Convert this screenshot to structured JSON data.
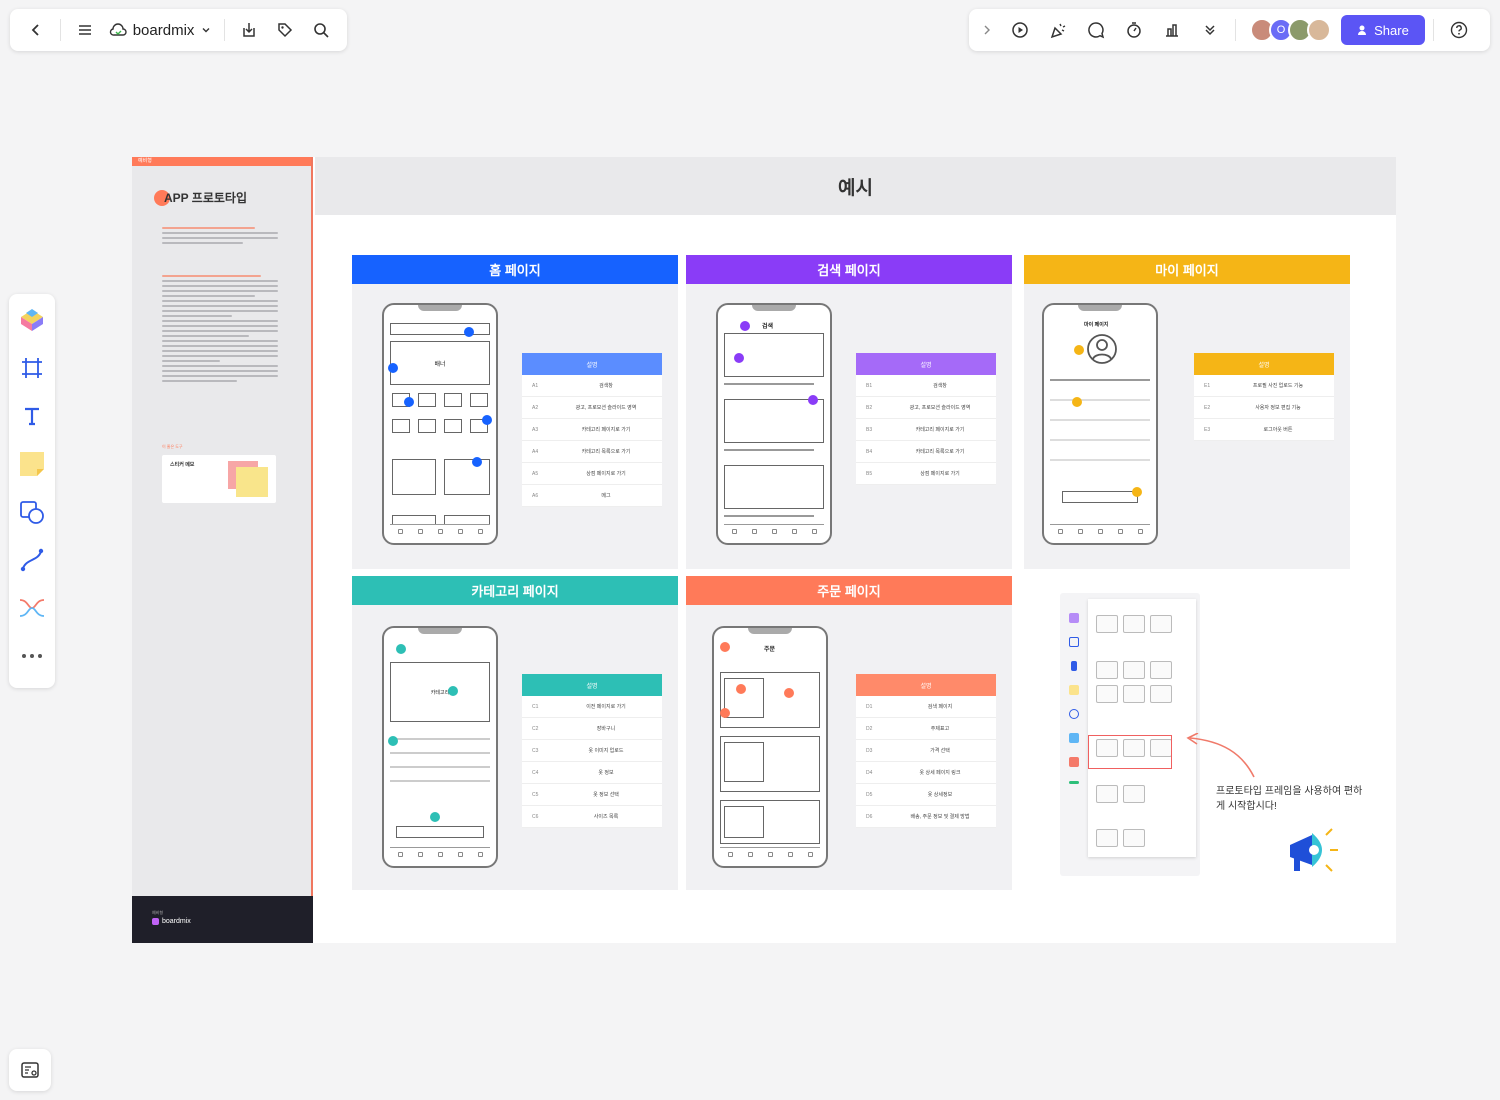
{
  "app": {
    "name": "boardmix",
    "share_label": "Share"
  },
  "colors": {
    "blue": "#1662ff",
    "purple": "#8a3cf7",
    "yellow": "#f5b516",
    "teal": "#2dbfb5",
    "coral": "#ff7a59",
    "share": "#5b55f5"
  },
  "toolbar_icons": {
    "left": [
      "back-icon",
      "menu-icon",
      "cloud-icon",
      "chevron-down-icon",
      "export-icon",
      "tag-icon",
      "search-icon"
    ],
    "right": [
      "chevron-right-icon",
      "play-icon",
      "celebrate-icon",
      "comment-icon",
      "timer-icon",
      "vote-icon",
      "more-icon",
      "help-icon"
    ],
    "side": [
      "template-icon",
      "frame-icon",
      "text-icon",
      "sticky-note-icon",
      "shape-icon",
      "connector-icon",
      "mindmap-icon",
      "more-dots-icon"
    ]
  },
  "sidebar": {
    "tag": "예비형",
    "title": "APP 프로토타입",
    "tip_title": "이 줄은 도구",
    "note_title": "스티커 메모",
    "footer_brand": "boardmix",
    "footer_small": "예비형"
  },
  "board": {
    "heading": "예시",
    "callout": "프로토타입 프레임을 사용하여 편하게 시작합시다!",
    "panels": [
      {
        "title": "홈 페이지",
        "desc_title": "설명",
        "rows": [
          {
            "k": "A1",
            "v": "검색창"
          },
          {
            "k": "A2",
            "v": "광고, 프로모션 슬라이드 영역"
          },
          {
            "k": "A3",
            "v": "카테고리 페이지로 가기"
          },
          {
            "k": "A4",
            "v": "카테고리 목록으로 가기"
          },
          {
            "k": "A5",
            "v": "상점 페이지로 가기"
          },
          {
            "k": "A6",
            "v": "메그"
          }
        ],
        "screen_label": "배너"
      },
      {
        "title": "검색 페이지",
        "desc_title": "설명",
        "rows": [
          {
            "k": "B1",
            "v": "검색창"
          },
          {
            "k": "B2",
            "v": "광고, 프로모션 슬라이드 영역"
          },
          {
            "k": "B3",
            "v": "카테고리 페이지로 가기"
          },
          {
            "k": "B4",
            "v": "카테고리 목록으로 가기"
          },
          {
            "k": "B5",
            "v": "상점 페이지로 가기"
          }
        ],
        "screen_label": "검색"
      },
      {
        "title": "마이 페이지",
        "desc_title": "설명",
        "rows": [
          {
            "k": "E1",
            "v": "프로필 사진 업로드 기능"
          },
          {
            "k": "E2",
            "v": "사용자 정보 편집 기능"
          },
          {
            "k": "E3",
            "v": "로그아웃 버튼"
          }
        ],
        "screen_label": "마이 페이지"
      },
      {
        "title": "카테고리 페이지",
        "desc_title": "설명",
        "rows": [
          {
            "k": "C1",
            "v": "이전 페이지로 가기"
          },
          {
            "k": "C2",
            "v": "장바구니"
          },
          {
            "k": "C3",
            "v": "옷 이미지 업로드"
          },
          {
            "k": "C4",
            "v": "옷 정보"
          },
          {
            "k": "C5",
            "v": "옷 정보 선택"
          },
          {
            "k": "C6",
            "v": "사이즈 목록"
          }
        ],
        "screen_label": "카테고리"
      },
      {
        "title": "주문 페이지",
        "desc_title": "설명",
        "rows": [
          {
            "k": "D1",
            "v": "검색 페이지"
          },
          {
            "k": "D2",
            "v": "주제표고"
          },
          {
            "k": "D3",
            "v": "가격 선택"
          },
          {
            "k": "D4",
            "v": "옷 상세 페이지 링크"
          },
          {
            "k": "D5",
            "v": "옷 상세정보"
          },
          {
            "k": "D6",
            "v": "배송, 주문 정보 및 결제 방법"
          }
        ],
        "screen_label": "주문"
      }
    ]
  }
}
